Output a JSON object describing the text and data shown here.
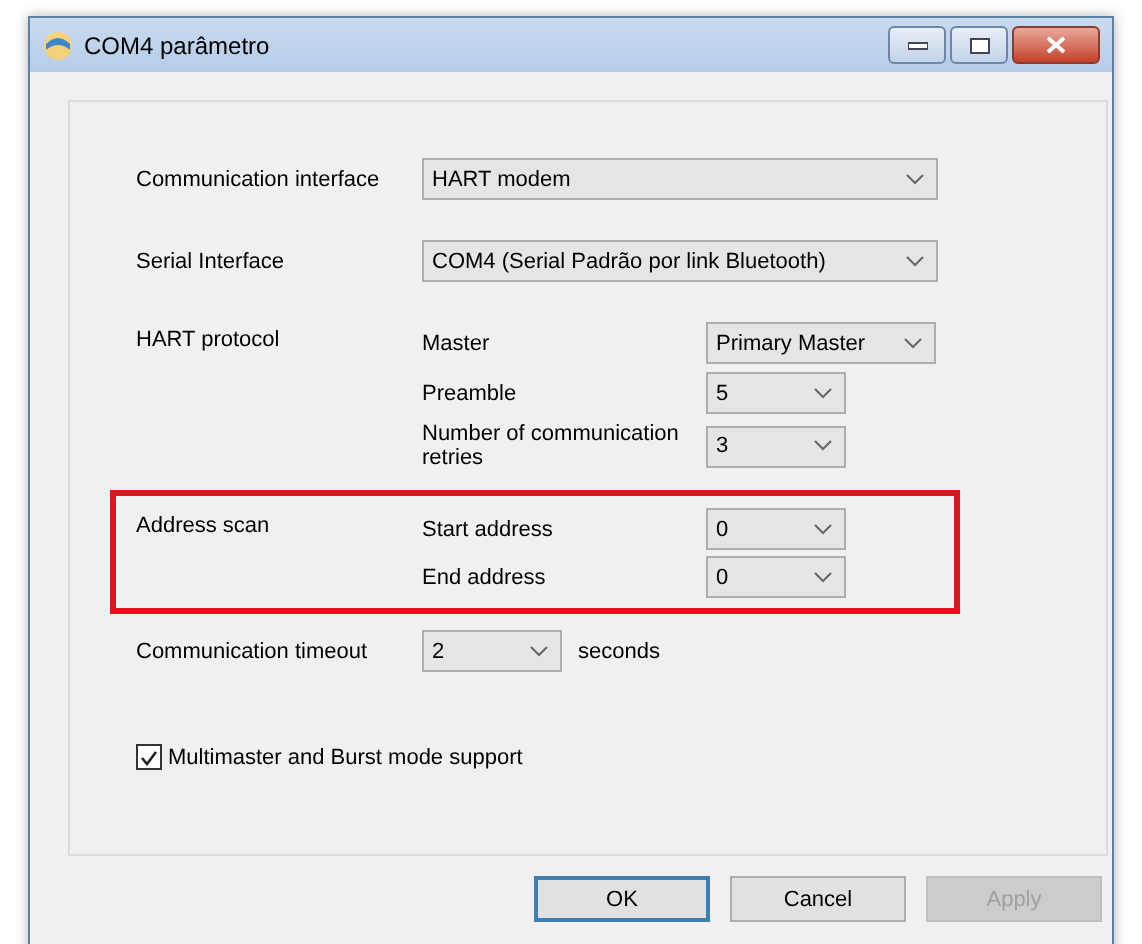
{
  "window": {
    "title": "COM4 parâmetro"
  },
  "communication_interface": {
    "label": "Communication interface",
    "value": "HART modem"
  },
  "serial_interface": {
    "label": "Serial Interface",
    "value": "COM4 (Serial Padrão por link Bluetooth)"
  },
  "hart_protocol": {
    "label": "HART protocol",
    "highlighted": false,
    "rows": [
      {
        "label": "Master",
        "value": "Primary Master",
        "kind": "wide"
      },
      {
        "label": "Preamble",
        "value": "5",
        "kind": "narrow"
      },
      {
        "label": "Number of communication retries",
        "value": "3",
        "kind": "narrow"
      }
    ]
  },
  "address_scan": {
    "label": "Address scan",
    "highlighted": true,
    "rows": [
      {
        "label": "Start address",
        "value": "0",
        "kind": "narrow"
      },
      {
        "label": "End address",
        "value": "0",
        "kind": "narrow"
      }
    ]
  },
  "communication_timeout": {
    "label": "Communication timeout",
    "value": "2",
    "unit": "seconds"
  },
  "multimaster": {
    "label": "Multimaster and Burst mode support",
    "checked": true
  },
  "buttons": [
    {
      "label": "OK",
      "disabled": false,
      "default": true
    },
    {
      "label": "Cancel",
      "disabled": false,
      "default": false
    },
    {
      "label": "Apply",
      "disabled": true,
      "default": false
    }
  ]
}
